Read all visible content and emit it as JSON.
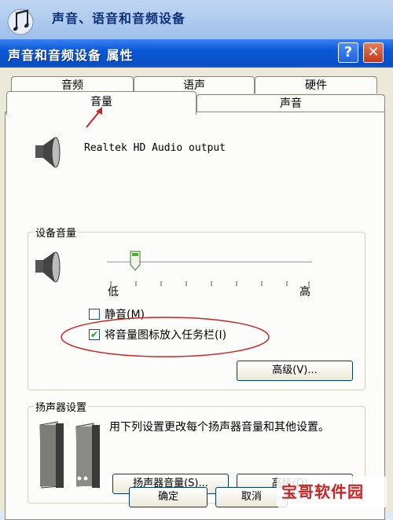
{
  "control_panel": {
    "title": "声音、语音和音频设备"
  },
  "dialog": {
    "title": "声音和音频设备 属性",
    "help": "?",
    "close": "✕"
  },
  "tabs": {
    "row1": [
      "音频",
      "语声",
      "硬件"
    ],
    "row2": [
      "音量",
      "声音"
    ]
  },
  "device": {
    "name": "Realtek HD Audio output"
  },
  "device_volume": {
    "label": "设备音量",
    "low": "低",
    "high": "高",
    "level": 0.12,
    "mute_label": "静音(M)",
    "mute_checked": false,
    "tray_label": "将音量图标放入任务栏(I)",
    "tray_checked": true,
    "advanced_button": "高级(V)..."
  },
  "speaker_settings": {
    "label": "扬声器设置",
    "description": "用下列设置更改每个扬声器音量和其他设置。",
    "speaker_volume_button": "扬声器音量(S)...",
    "advanced_button": "高级(D)..."
  },
  "footer": {
    "ok": "确定",
    "cancel": "取消"
  },
  "watermark": {
    "text": "宝哥软件园"
  },
  "colors": {
    "accent": "#0a58d6",
    "annotation": "#c82525"
  }
}
